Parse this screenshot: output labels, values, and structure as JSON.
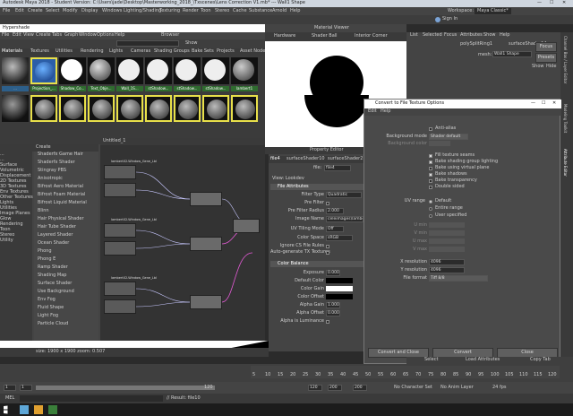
{
  "window_title": "Autodesk Maya 2018 - Student Version: C:\\Users\\jade\\Desktop\\Masterworking_2018_\\Txscenes\\Lens Correction V1.mb*  ---  Wall1 Shape",
  "workspace": {
    "label": "Workspace:",
    "value": "Maya Classic*"
  },
  "sign_in": "Sign In",
  "main_menu": [
    "File",
    "Edit",
    "Create",
    "Select",
    "Modify",
    "Display",
    "Windows",
    "Lighting/Shading",
    "Texturing",
    "Render",
    "Toon",
    "Stereo",
    "Cache",
    "Substance",
    "Arnold",
    "Help"
  ],
  "hypershade": {
    "title": "Hypershade",
    "menu": [
      "File",
      "Edit",
      "View",
      "Create",
      "Tabs",
      "Graph",
      "Window",
      "Options",
      "Help"
    ],
    "browser_title": "Browser",
    "show_label": "Show",
    "browser_tabs": [
      "Materials",
      "Textures",
      "Utilities",
      "Rendering",
      "Lights",
      "Cameras",
      "Shading Groups",
      "Bake Sets",
      "Projects",
      "Asset Nodes"
    ],
    "swatch_labels_row1": [
      "...",
      "Projection_...",
      "Shadow_Co...",
      "Text_Obje...",
      "Wall_1S...",
      "stShadow...",
      "stShadow...",
      "stShadow...",
      "lambert1",
      "surfaceSh..."
    ],
    "create_title": "Create",
    "node_categories": [
      "...",
      "...",
      "Surface",
      "Volumetric",
      "Displacement",
      "2D Textures",
      "3D Textures",
      "Env Textures",
      "Other Textures",
      "Lights",
      "Utilities",
      "Image Planes",
      "Glow",
      "Rendering",
      "Toon",
      "Stereo",
      "Utility"
    ],
    "shader_list": [
      "Shaderfx Game Hair",
      "Shaderfx Shader",
      "Stingray PBS",
      "Anisotropic",
      "Bifrost Aero Material",
      "Bifrost Foam Material",
      "Bifrost Liquid Material",
      "Blinn",
      "Hair Physical Shader",
      "Hair Tube Shader",
      "Layered Shader",
      "Ocean Shader",
      "Phong",
      "Phong E",
      "Ramp Shader",
      "Shading Map",
      "Surface Shader",
      "Use Background",
      "Env Fog",
      "Fluid Shape",
      "Light Fog",
      "Particle Cloud"
    ],
    "editor_tab": "Untitled_1",
    "node_names": [
      "lambert02-Window_Gene_Lbl",
      "lambert02-Window_Gene_Lbl",
      "lambert02-Window_Gene_Lbl",
      "lambert02-Window_Gene_Lbl",
      "lambert02-Shadow_Gene_Lbl",
      "lambert02-Shadow_Gene_Lbl"
    ]
  },
  "material_viewer": {
    "title": "Material Viewer",
    "renderer": "Hardware",
    "shape": "Shader Ball",
    "env": "Interior Corner"
  },
  "property_editor": {
    "title": "Property Editor",
    "tabs": [
      "file4",
      "surfaceShader10",
      "surfaceShader2",
      "place2d"
    ],
    "node_label": "file:",
    "node_value": "file4",
    "view_label": "View: Lookdev",
    "section_file": "File Attributes",
    "rows": [
      {
        "label": "Filter Type",
        "value": "Quadratic"
      },
      {
        "label": "Pre Filter",
        "value": ""
      },
      {
        "label": "Pre Filter Radius",
        "value": "2.000"
      },
      {
        "label": "Image Name",
        "value": "celeimages\\lambert2..."
      },
      {
        "label": "UV Tiling Mode",
        "value": "Off"
      },
      {
        "label": "Color Space",
        "value": "sRGB"
      },
      {
        "label": "Ignore CS File Rules",
        "value": ""
      },
      {
        "label": "Auto-generate TX Textures",
        "value": ""
      }
    ],
    "section_color": "Color Balance",
    "color_rows": [
      {
        "label": "Exposure",
        "value": "0.000"
      },
      {
        "label": "Default Color",
        "value": ""
      },
      {
        "label": "Color Gain",
        "value": ""
      },
      {
        "label": "Color Offset",
        "value": ""
      },
      {
        "label": "Alpha Gain",
        "value": "1.000"
      },
      {
        "label": "Alpha Offset",
        "value": "0.000"
      },
      {
        "label": "Alpha is Luminance",
        "value": ""
      }
    ]
  },
  "attr_panel": {
    "tabs": [
      "List",
      "Selected",
      "Focus",
      "Attributes",
      "Show",
      "Help"
    ],
    "node_tab": "polySplitRing1",
    "node_tab2": "surfaceShader14",
    "mesh_label": "mesh:",
    "mesh_value": "Wall1 Shape",
    "focus": "Focus",
    "presets": "Presets",
    "show": "Show",
    "hide": "Hide"
  },
  "right_strip_labels": [
    "Channel Box / Layer Editor",
    "Modeling Toolkit",
    "Attribute Editor"
  ],
  "dialog": {
    "title": "Convert to File Texture Options",
    "menu": [
      "Edit",
      "Help"
    ],
    "anti_alias_label": "Anti-alias",
    "bg_mode_label": "Background mode",
    "bg_mode_value": "Shader default",
    "bg_color_label": "Background color",
    "checks": [
      {
        "label": "Fill texture seams",
        "on": true
      },
      {
        "label": "Bake shading group lighting",
        "on": true
      },
      {
        "label": "Bake using virtual plane",
        "on": false
      },
      {
        "label": "Bake shadows",
        "on": true
      },
      {
        "label": "Bake transparency",
        "on": false
      },
      {
        "label": "Double sided",
        "on": false
      }
    ],
    "uv_range_label": "UV range",
    "uv_options": [
      "Default",
      "Entire range",
      "User specified"
    ],
    "uv_fields": [
      "U min",
      "V min",
      "U max",
      "V max"
    ],
    "x_res_label": "X resolution",
    "x_res_value": "4096",
    "y_res_label": "Y resolution",
    "y_res_value": "4096",
    "format_label": "File format",
    "format_value": "Tiff 8/8",
    "btn_convert_close": "Convert and Close",
    "btn_convert": "Convert",
    "btn_close": "Close"
  },
  "status_size": "size: 1900 x 1900 zoom: 0.507",
  "timeline_ticks": [
    "5",
    "10",
    "15",
    "20",
    "25",
    "30",
    "35",
    "40",
    "45",
    "50",
    "55",
    "60",
    "65",
    "70",
    "75",
    "80",
    "85",
    "90",
    "95",
    "100",
    "105",
    "110",
    "115",
    "120"
  ],
  "bottom_buttons": [
    "Select",
    "Load Attributes",
    "Copy Tab"
  ],
  "range": {
    "start": "1",
    "cur_start": "1",
    "end": "120",
    "end2": "120",
    "max": "200",
    "anim_end": "200"
  },
  "range_opts": [
    "No Character Set",
    "No Anim Layer",
    "24 fps"
  ],
  "cmd": {
    "label": "MEL",
    "result": "// Result: file10"
  }
}
